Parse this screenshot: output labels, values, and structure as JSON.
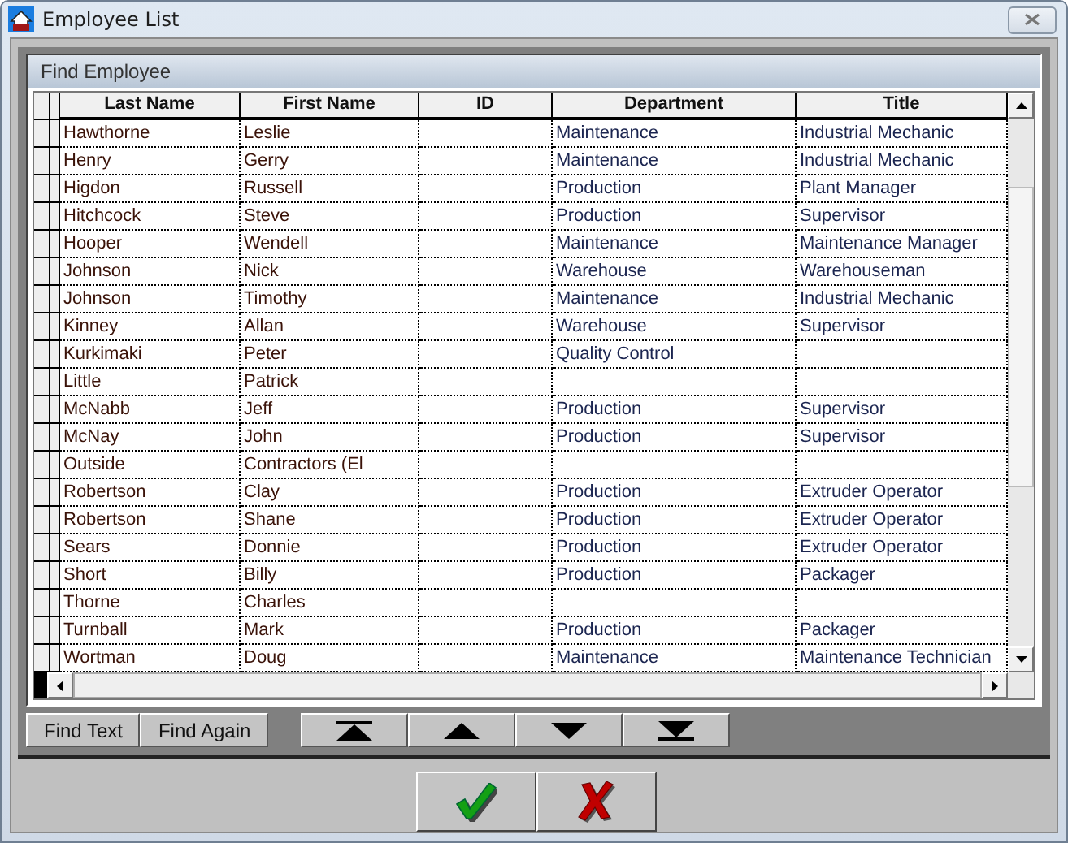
{
  "window": {
    "title": "Employee List"
  },
  "panel": {
    "title": "Find Employee"
  },
  "table": {
    "columns": [
      "Last Name",
      "First Name",
      "ID",
      "Department",
      "Title"
    ],
    "rows": [
      {
        "last": "Hawthorne",
        "first": "Leslie",
        "department": "Maintenance",
        "title": "Industrial Mechanic"
      },
      {
        "last": "Henry",
        "first": "Gerry",
        "department": "Maintenance",
        "title": "Industrial Mechanic"
      },
      {
        "last": "Higdon",
        "first": "Russell",
        "department": "Production",
        "title": "Plant Manager"
      },
      {
        "last": "Hitchcock",
        "first": "Steve",
        "department": "Production",
        "title": "Supervisor"
      },
      {
        "last": "Hooper",
        "first": "Wendell",
        "department": "Maintenance",
        "title": "Maintenance Manager"
      },
      {
        "last": "Johnson",
        "first": "Nick",
        "department": "Warehouse",
        "title": "Warehouseman"
      },
      {
        "last": "Johnson",
        "first": "Timothy",
        "department": "Maintenance",
        "title": "Industrial Mechanic"
      },
      {
        "last": "Kinney",
        "first": "Allan",
        "department": "Warehouse",
        "title": "Supervisor"
      },
      {
        "last": "Kurkimaki",
        "first": "Peter",
        "department": "Quality Control"
      },
      {
        "last": "Little",
        "first": "Patrick"
      },
      {
        "last": "McNabb",
        "first": "Jeff",
        "department": "Production",
        "title": "Supervisor"
      },
      {
        "last": "McNay",
        "first": "John",
        "department": "Production",
        "title": "Supervisor"
      },
      {
        "last": "Outside",
        "first": "Contractors (El"
      },
      {
        "last": "Robertson",
        "first": "Clay",
        "department": "Production",
        "title": "Extruder Operator"
      },
      {
        "last": "Robertson",
        "first": "Shane",
        "department": "Production",
        "title": "Extruder Operator"
      },
      {
        "last": "Sears",
        "first": "Donnie",
        "department": "Production",
        "title": "Extruder Operator"
      },
      {
        "last": "Short",
        "first": "Billy",
        "department": "Production",
        "title": "Packager"
      },
      {
        "last": "Thorne",
        "first": "Charles"
      },
      {
        "last": "Turnball",
        "first": "Mark",
        "department": "Production",
        "title": "Packager"
      },
      {
        "last": "Wortman",
        "first": "Doug",
        "department": "Maintenance",
        "title": "Maintenance Technician"
      }
    ]
  },
  "find_buttons": [
    "Find Text",
    "Find Again"
  ],
  "nav_buttons": [
    {
      "kind": "first"
    },
    {
      "kind": "previous"
    },
    {
      "kind": "next"
    },
    {
      "kind": "last"
    }
  ],
  "dialog_buttons": [
    {
      "kind": "ok"
    },
    {
      "kind": "cancel"
    }
  ]
}
